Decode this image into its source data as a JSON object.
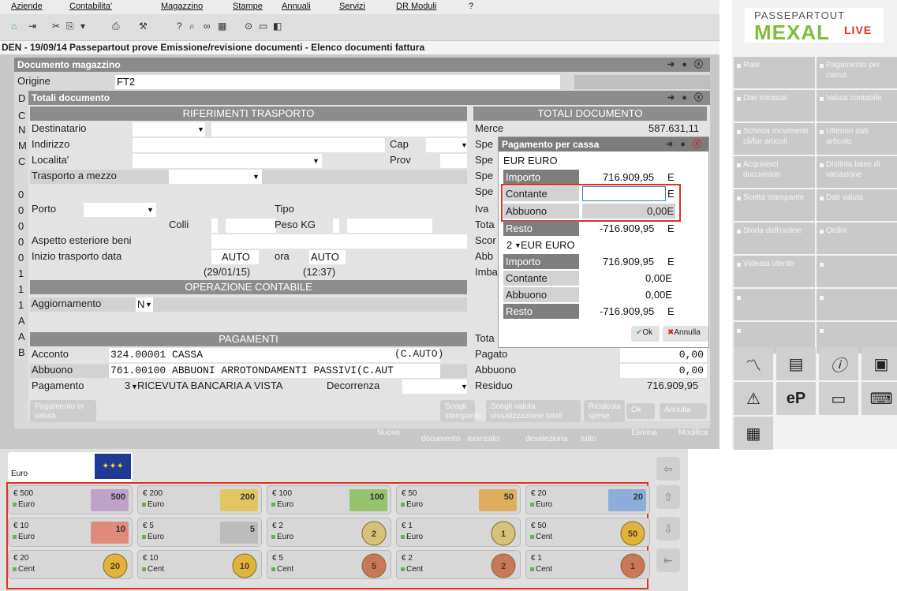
{
  "menu": [
    "Aziende",
    "Contabilita'",
    "Magazzino",
    "Stampe",
    "Annuali",
    "Servizi",
    "DR  Moduli",
    "?"
  ],
  "title": "DEN - 19/09/14 Passepartout prove Emissione/revisione documenti - Elenco documenti fattura",
  "logo": {
    "top": "PASSEPARTOUT",
    "main": "MEXAL",
    "sub": "LIVE"
  },
  "doc_window": {
    "title": "Documento magazzino",
    "origine_label": "Origine",
    "origine_value": "FT2"
  },
  "totals_window": {
    "title": "Totali documento"
  },
  "trasporto": {
    "header": "RIFERIMENTI TRASPORTO",
    "destinatario": "Destinatario",
    "indirizzo": "Indirizzo",
    "cap": "Cap",
    "localita": "Localita'",
    "prov": "Prov",
    "trasporto": "Trasporto a mezzo",
    "porto": "Porto",
    "tipo": "Tipo",
    "colli": "Colli",
    "peso": "Peso KG",
    "aspetto": "Aspetto esteriore beni",
    "inizio": "Inizio trasporto  data",
    "data_val": "AUTO",
    "ora": "ora",
    "ora_val": "AUTO",
    "data_sub": "(29/01/15)",
    "ora_sub": "(12:37)"
  },
  "contabile": {
    "header": "OPERAZIONE CONTABILE",
    "aggiornamento": "Aggiornamento",
    "agg_val": "N"
  },
  "pagamenti": {
    "header": "PAGAMENTI",
    "acconto": "Acconto",
    "acconto_val": "324.00001 CASSA",
    "acconto_tag": "(C.AUTO)",
    "abbuono": "Abbuono",
    "abbuono_val": "761.00100 ABBUONI ARROTONDAMENTI PASSIVI(C.AUT",
    "pagamento": "Pagamento",
    "pagamento_val": "3",
    "pagamento_desc": "RICEVUTA BANCARIA A VISTA",
    "decorrenza": "Decorrenza"
  },
  "totali": {
    "header": "TOTALI DOCUMENTO",
    "merce": "Merce",
    "merce_val": "587.631,11",
    "tot": "Tota",
    "pagato": "Pagato",
    "pagato_val": "0,00",
    "abbuono": "Abbuono",
    "abbuono_val": "0,00",
    "residuo": "Residuo",
    "residuo_val": "716.909,95",
    "labels": [
      "Spe",
      "Spe",
      "Spe",
      "Spe",
      "Iva",
      "Tota",
      "Scor",
      "Abb",
      "Imba"
    ]
  },
  "left_letters": [
    "D",
    "C",
    "N",
    "M",
    "C",
    "0",
    "0",
    "0",
    "0",
    "0",
    "1",
    "1",
    "1",
    "A",
    "A",
    "B"
  ],
  "popup": {
    "title": "Pagamento per cassa",
    "cur1": "EUR EURO",
    "importo": "Importo",
    "importo_val": "716.909,95",
    "e": "E",
    "contante": "Contante",
    "contante_val": "",
    "abbuono": "Abbuono",
    "abbuono_val": "0,00E",
    "resto": "Resto",
    "resto_val": "-716.909,95",
    "cur2_num": "2",
    "cur2": "EUR EURO",
    "importo2_val": "716.909,95",
    "contante2_val": "0,00E",
    "abbuono2_val": "0,00E",
    "resto2_val": "-716.909,95",
    "ok": "Ok",
    "annulla": "Annulla"
  },
  "bottom_buttons": [
    "Pagamento in valuta",
    "Scegli stampante",
    "Scegli valuta visualizzazione totali",
    "Ricalcola spese",
    "Ok",
    "Annulla"
  ],
  "under_buttons": [
    "Nuovo",
    "documento",
    "avanzato",
    "deseleziona",
    "tutto",
    "Elimina",
    "Modifica"
  ],
  "right_panel": [
    [
      "Rate",
      "Pagamento per cassa"
    ],
    [
      "Dati intrastat",
      "Valuta contabile"
    ],
    [
      "Scheda movimenti cli/for articoli",
      "Ulteriori dati articolo"
    ],
    [
      "Acquisisci docuvision",
      "Distinta base di variazione"
    ],
    [
      "Scelta stampante",
      "Dati valuta"
    ],
    [
      "Storia dell'ordine",
      "Ordini"
    ],
    [
      "Videata utente",
      ""
    ]
  ],
  "currency": {
    "name": "Euro"
  },
  "coins": [
    [
      "€ 500",
      "Euro",
      "€ 200",
      "Euro",
      "€ 100",
      "Euro",
      "€ 50",
      "Euro",
      "€ 20",
      "Euro"
    ],
    [
      "€ 10",
      "Euro",
      "€ 5",
      "Euro",
      "€ 2",
      "Euro",
      "€ 1",
      "Euro",
      "€ 50",
      "Cent"
    ],
    [
      "€ 20",
      "Cent",
      "€ 10",
      "Cent",
      "€ 5",
      "Cent",
      "€ 2",
      "Cent",
      "€ 1",
      "Cent"
    ]
  ],
  "coin_marks": [
    "500",
    "200",
    "100",
    "50",
    "20",
    "10",
    "5",
    "2",
    "1",
    "50",
    "20",
    "10",
    "5",
    "2",
    "1"
  ]
}
